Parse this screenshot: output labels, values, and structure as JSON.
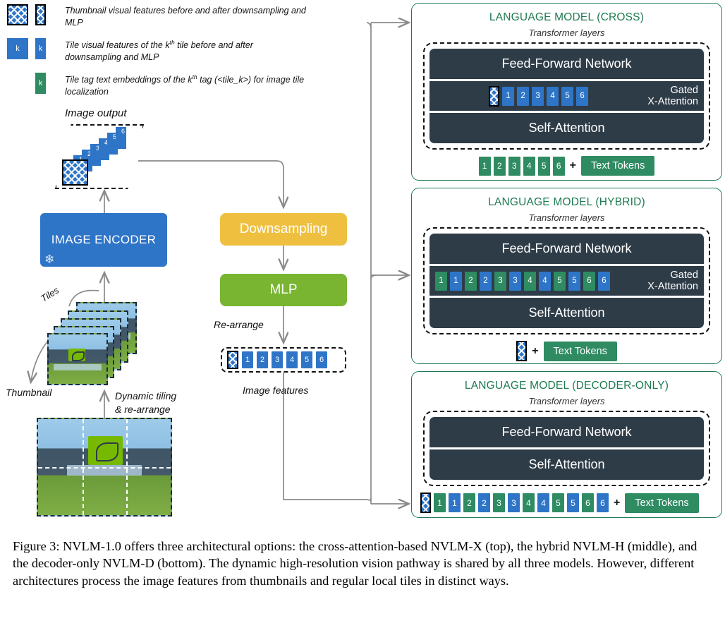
{
  "legend": {
    "items": [
      {
        "icons": [
          "thumbnail-large",
          "thumbnail-small"
        ],
        "text_html": "Thumbnail visual features before and after downsampling and MLP",
        "text": "Thumbnail visual features before and after downsampling and MLP"
      },
      {
        "icons": [
          "tile-large-k",
          "tile-small-k"
        ],
        "text": "Tile visual features of the kth tile before and after downsampling and MLP",
        "chip_label": "k"
      },
      {
        "icons": [
          "tag-green-k"
        ],
        "text": "Tile tag text embeddings of the kth tag (<tile_k>) for image tile localization",
        "chip_label": "k"
      }
    ]
  },
  "pipeline": {
    "image_output_label": "Image output",
    "encoder_label": "IMAGE ENCODER",
    "encoder_frozen_icon": "snowflake-icon",
    "tiles_label": "Tiles",
    "thumbnail_label": "Thumbnail",
    "dynamic_tiling_label": "Dynamic tiling\n& re-arrange",
    "dynamic_tiling_line1": "Dynamic tiling",
    "dynamic_tiling_line2": "& re-arrange",
    "downsampling_label": "Downsampling",
    "mlp_label": "MLP",
    "rearrange_label": "Re-arrange",
    "image_features_label": "Image features",
    "stack_tile_numbers": [
      "1",
      "2",
      "3",
      "4",
      "5",
      "6"
    ],
    "feature_tile_numbers": [
      "1",
      "2",
      "3",
      "4",
      "5",
      "6"
    ]
  },
  "panels": [
    {
      "id": "cross",
      "title": "LANGUAGE MODEL (CROSS)",
      "transformer_label": "Transformer layers",
      "ffn_label": "Feed-Forward Network",
      "self_attention_label": "Self-Attention",
      "xattn_label_line1": "Gated",
      "xattn_label_line2": "X-Attention",
      "xattn_has_thumbnail": true,
      "xattn_tokens": [
        {
          "label": "1",
          "color": "blue"
        },
        {
          "label": "2",
          "color": "blue"
        },
        {
          "label": "3",
          "color": "blue"
        },
        {
          "label": "4",
          "color": "blue"
        },
        {
          "label": "5",
          "color": "blue"
        },
        {
          "label": "6",
          "color": "blue"
        }
      ],
      "bottom_has_thumbnail": false,
      "bottom_tokens": [
        {
          "label": "1",
          "color": "green"
        },
        {
          "label": "2",
          "color": "green"
        },
        {
          "label": "3",
          "color": "green"
        },
        {
          "label": "4",
          "color": "green"
        },
        {
          "label": "5",
          "color": "green"
        },
        {
          "label": "6",
          "color": "green"
        }
      ],
      "plus": "+",
      "text_tokens_label": "Text Tokens"
    },
    {
      "id": "hybrid",
      "title": "LANGUAGE MODEL (HYBRID)",
      "transformer_label": "Transformer layers",
      "ffn_label": "Feed-Forward Network",
      "self_attention_label": "Self-Attention",
      "xattn_label_line1": "Gated",
      "xattn_label_line2": "X-Attention",
      "xattn_has_thumbnail": false,
      "xattn_tokens": [
        {
          "label": "1",
          "color": "green"
        },
        {
          "label": "1",
          "color": "blue"
        },
        {
          "label": "2",
          "color": "green"
        },
        {
          "label": "2",
          "color": "blue"
        },
        {
          "label": "3",
          "color": "green"
        },
        {
          "label": "3",
          "color": "blue"
        },
        {
          "label": "4",
          "color": "green"
        },
        {
          "label": "4",
          "color": "blue"
        },
        {
          "label": "5",
          "color": "green"
        },
        {
          "label": "5",
          "color": "blue"
        },
        {
          "label": "6",
          "color": "green"
        },
        {
          "label": "6",
          "color": "blue"
        }
      ],
      "bottom_has_thumbnail": true,
      "bottom_tokens": [],
      "plus": "+",
      "text_tokens_label": "Text Tokens"
    },
    {
      "id": "decoder-only",
      "title": "LANGUAGE MODEL (DECODER-ONLY)",
      "transformer_label": "Transformer layers",
      "ffn_label": "Feed-Forward Network",
      "self_attention_label": "Self-Attention",
      "xattn_label_line1": "",
      "xattn_label_line2": "",
      "xattn_has_thumbnail": false,
      "xattn_tokens": [],
      "bottom_has_thumbnail": true,
      "bottom_tokens": [
        {
          "label": "1",
          "color": "green"
        },
        {
          "label": "1",
          "color": "blue"
        },
        {
          "label": "2",
          "color": "green"
        },
        {
          "label": "2",
          "color": "blue"
        },
        {
          "label": "3",
          "color": "green"
        },
        {
          "label": "3",
          "color": "blue"
        },
        {
          "label": "4",
          "color": "green"
        },
        {
          "label": "4",
          "color": "blue"
        },
        {
          "label": "5",
          "color": "green"
        },
        {
          "label": "5",
          "color": "blue"
        },
        {
          "label": "6",
          "color": "green"
        },
        {
          "label": "6",
          "color": "blue"
        }
      ],
      "plus": "+",
      "text_tokens_label": "Text Tokens"
    }
  ],
  "caption": "Figure 3: NVLM-1.0 offers three architectural options: the cross-attention-based NVLM-X (top), the hybrid NVLM-H (middle), and the decoder-only NVLM-D (bottom). The dynamic high-resolution vision pathway is shared by all three models. However, different architectures process the image features from thumbnails and regular local tiles in distinct ways.",
  "colors": {
    "blue": "#2E75C8",
    "green": "#2E8B62",
    "yellow": "#EFC040",
    "mlp_green": "#79B531",
    "dark": "#2E3C48",
    "panel_border": "#1E7A52",
    "arrow": "#8a8a8a"
  }
}
